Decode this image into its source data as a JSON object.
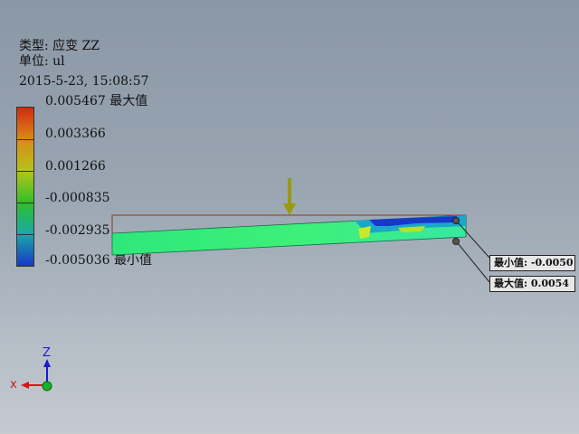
{
  "result": {
    "type_line": "类型: 应变 ZZ",
    "unit_line": "单位: ul",
    "datetime": "2015-5-23, 15:08:57"
  },
  "legend": {
    "labels": [
      "0.005467 最大值",
      "0.003366",
      "0.001266",
      "-0.000835",
      "-0.002935",
      "-0.005036 最小值"
    ],
    "colors": [
      "#d42a10",
      "#d98a18",
      "#b6c41a",
      "#2fbf28",
      "#1aa8a8",
      "#1838c8"
    ]
  },
  "callouts": {
    "min": "最小值: -0.0050",
    "max": "最大值: 0.0054"
  },
  "axes": {
    "z": "Z",
    "x": "x"
  }
}
